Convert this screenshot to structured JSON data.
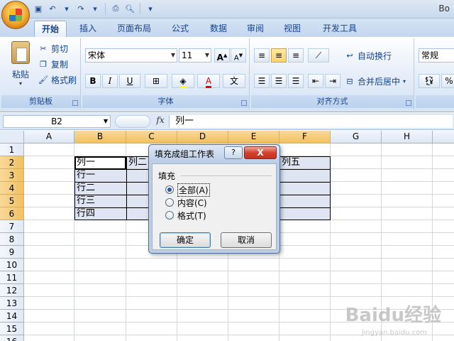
{
  "window": {
    "title_fragment": "Bo"
  },
  "tabs": [
    "开始",
    "插入",
    "页面布局",
    "公式",
    "数据",
    "审阅",
    "视图",
    "开发工具"
  ],
  "ribbon": {
    "clipboard": {
      "paste": "粘贴",
      "cut": "剪切",
      "copy": "复制",
      "format_painter": "格式刷",
      "label": "剪贴板"
    },
    "font": {
      "font_name": "宋体",
      "font_size": "11",
      "grow": "A",
      "shrink": "A",
      "bold": "B",
      "italic": "I",
      "underline": "U",
      "label": "字体",
      "phonetic": "文"
    },
    "alignment": {
      "wrap_text": "自动换行",
      "merge_center": "合并后居中",
      "label": "对齐方式"
    },
    "number": {
      "format": "常规",
      "percent": "%"
    }
  },
  "formula_bar": {
    "name_box": "B2",
    "fx": "fx",
    "content": "列一"
  },
  "grid": {
    "columns": [
      "A",
      "B",
      "C",
      "D",
      "E",
      "F",
      "G",
      "H"
    ],
    "rows": [
      "1",
      "2",
      "3",
      "4",
      "5",
      "6",
      "7",
      "8",
      "9",
      "10",
      "11",
      "12",
      "13",
      "14",
      "15",
      "16"
    ],
    "cells": {
      "B2": "列一",
      "C2": "列二",
      "F2": "列五",
      "B3": "行一",
      "B4": "行二",
      "B5": "行三",
      "B6": "行四"
    }
  },
  "dialog": {
    "title": "填充成组工作表",
    "help": "?",
    "close": "X",
    "section": "填充",
    "options": [
      "全部(A)",
      "内容(C)",
      "格式(T)"
    ],
    "selected": 0,
    "ok": "确定",
    "cancel": "取消"
  },
  "watermark": {
    "main": "Baidu经验",
    "sub": "jingyan.baidu.com"
  }
}
